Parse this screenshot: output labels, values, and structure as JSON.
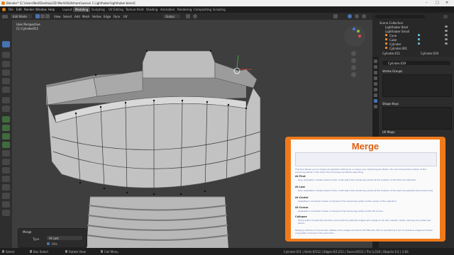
{
  "window": {
    "title": "Blender* [C:\\Users\\Neil\\Desktop\\3D World\\Skillshare\\Lesson 1 Lighthaber\\lighthaber.blend]"
  },
  "menu": [
    "File",
    "Edit",
    "Render",
    "Window",
    "Help"
  ],
  "workspaces": [
    "Layout",
    "Modeling",
    "Sculpting",
    "UV Editing",
    "Texture Paint",
    "Shading",
    "Animation",
    "Rendering",
    "Compositing",
    "Scripting"
  ],
  "header": {
    "mode": "Edit Mode",
    "items": [
      "View",
      "Select",
      "Add",
      "Mesh",
      "Vertex",
      "Edge",
      "Face",
      "UV"
    ],
    "transform": "Global"
  },
  "viewport": {
    "view_name": "User Perspective",
    "object_name": "(1) Cylinder011"
  },
  "outliner": {
    "root": "Scene Collection",
    "rows": [
      "Lighthaber Boat",
      "Lighthaber Small",
      "Cone",
      "Cube",
      "Cylinder",
      "Cylinder.001"
    ],
    "tabs": [
      "Cylinder.011",
      "Cylinder.019"
    ]
  },
  "properties": {
    "object_name": "Cylinder.019",
    "sections": [
      "Vertex Groups",
      "Shape Keys",
      "UV Maps"
    ]
  },
  "operator_panel": {
    "title": "Merge",
    "type_label": "Type",
    "type_value": "At Last",
    "uvs_label": "UVs"
  },
  "status_bar": {
    "left": [
      "Select",
      "Box Select",
      "Rotate View",
      "Call Menu"
    ],
    "right": "Cylinder.011 | Verts:6/512 | Edges:6/1,011 | Faces:0/512 | Tris:1,018 | Objects:1/1 | 2.83"
  },
  "overlay": {
    "title": "Merge",
    "intro": "This tool allows you to merge all selected vertices to a unique one, dissolving all others. You can choose the location of the surviving vertex in the menu this tool pops up before executing.",
    "options": [
      {
        "name": "At First",
        "desc": "Only available in Vertex select mode, it will place the remaining vertex at the location of the first one selected."
      },
      {
        "name": "At Last",
        "desc": "Only available in Vertex select mode, it will place the remaining vertex at the location of the last one selected (the active one)."
      },
      {
        "name": "At Center",
        "desc": "Available in all select modes, it will place the remaining vertex at the center of the selection."
      },
      {
        "name": "At Cursor",
        "desc": "Available in all select modes, it will place the remaining vertex at the 3D Cursor."
      },
      {
        "name": "Collapse",
        "desc": "Every island of selected vertices (connected by selected edges) will merge on its own median center, leaving one vertex per island."
      }
    ],
    "footer": "Merging vertices of course also deletes some edges and faces. But Blender will do everything it can to preserve edges and faces only partly involved in the reduction."
  },
  "colors": {
    "accent": "#4772b3",
    "overlay_border": "#f07a1a",
    "overlay_title": "#e06010"
  }
}
